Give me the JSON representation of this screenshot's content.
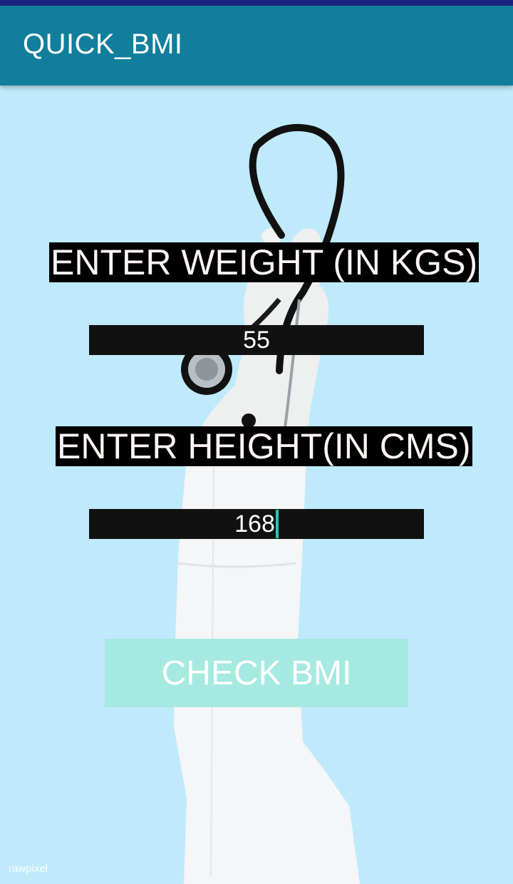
{
  "app_bar": {
    "title": "QUICK_BMI"
  },
  "form": {
    "weight_label": "ENTER WEIGHT (IN KGS)",
    "weight_value": "55",
    "height_label": "ENTER HEIGHT(IN CMS)",
    "height_value": "168",
    "check_button_label": "CHECK BMI"
  },
  "background": {
    "watermark": "rawpixel",
    "subject": "gloved hand holding stethoscope icon"
  },
  "colors": {
    "status_bar": "#1a237e",
    "app_bar": "#117e9c",
    "background": "#bfeafb",
    "button": "#a6e9e1",
    "cursor": "#26c6b0"
  }
}
